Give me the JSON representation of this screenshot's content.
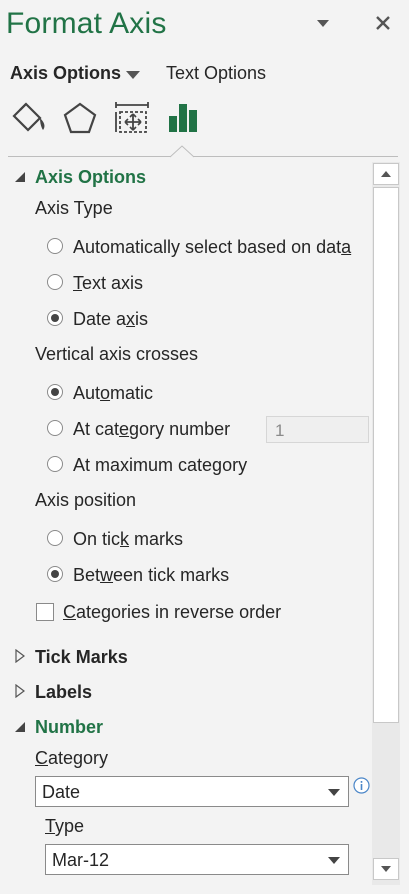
{
  "header": {
    "title": "Format Axis",
    "dropdown_icon": "chevron-down-icon",
    "close_icon": "close-icon"
  },
  "tabs": {
    "active": "Axis Options",
    "inactive": "Text Options"
  },
  "icon_tabs": [
    "fill-line-icon",
    "effects-icon",
    "size-properties-icon",
    "axis-options-icon"
  ],
  "sections": {
    "axis_options": {
      "label": "Axis Options",
      "axis_type": {
        "label": "Axis Type",
        "options": [
          {
            "pre": "Automatically select based on dat",
            "u": "a",
            "post": "",
            "selected": false
          },
          {
            "pre": "",
            "u": "T",
            "post": "ext axis",
            "selected": false
          },
          {
            "pre": "Date a",
            "u": "x",
            "post": "is",
            "selected": true
          }
        ]
      },
      "vertical_axis_crosses": {
        "label": "Vertical axis crosses",
        "options": [
          {
            "pre": "Aut",
            "u": "o",
            "post": "matic",
            "selected": true
          },
          {
            "pre": "At cat",
            "u": "e",
            "post": "gory number",
            "selected": false
          },
          {
            "pre": "At maximum cate",
            "u": "g",
            "post": "ory",
            "selected": false
          }
        ],
        "category_number_value": "1"
      },
      "axis_position": {
        "label": "Axis position",
        "options": [
          {
            "pre": "On tic",
            "u": "k",
            "post": " marks",
            "selected": false
          },
          {
            "pre": "Bet",
            "u": "w",
            "post": "een tick marks",
            "selected": true
          }
        ]
      },
      "reverse_order": {
        "pre": "",
        "u": "C",
        "post": "ategories in reverse order",
        "checked": false
      }
    },
    "tick_marks": {
      "label": "Tick Marks"
    },
    "labels": {
      "label": "Labels"
    },
    "number": {
      "label": "Number",
      "category_label_u": "C",
      "category_label_rest": "ategory",
      "category_value": "Date",
      "type_label_u": "T",
      "type_label_rest": "ype",
      "type_value": "Mar-12"
    }
  },
  "colors": {
    "accent": "#217346",
    "text": "#262626",
    "panel": "#f3f3f3"
  }
}
